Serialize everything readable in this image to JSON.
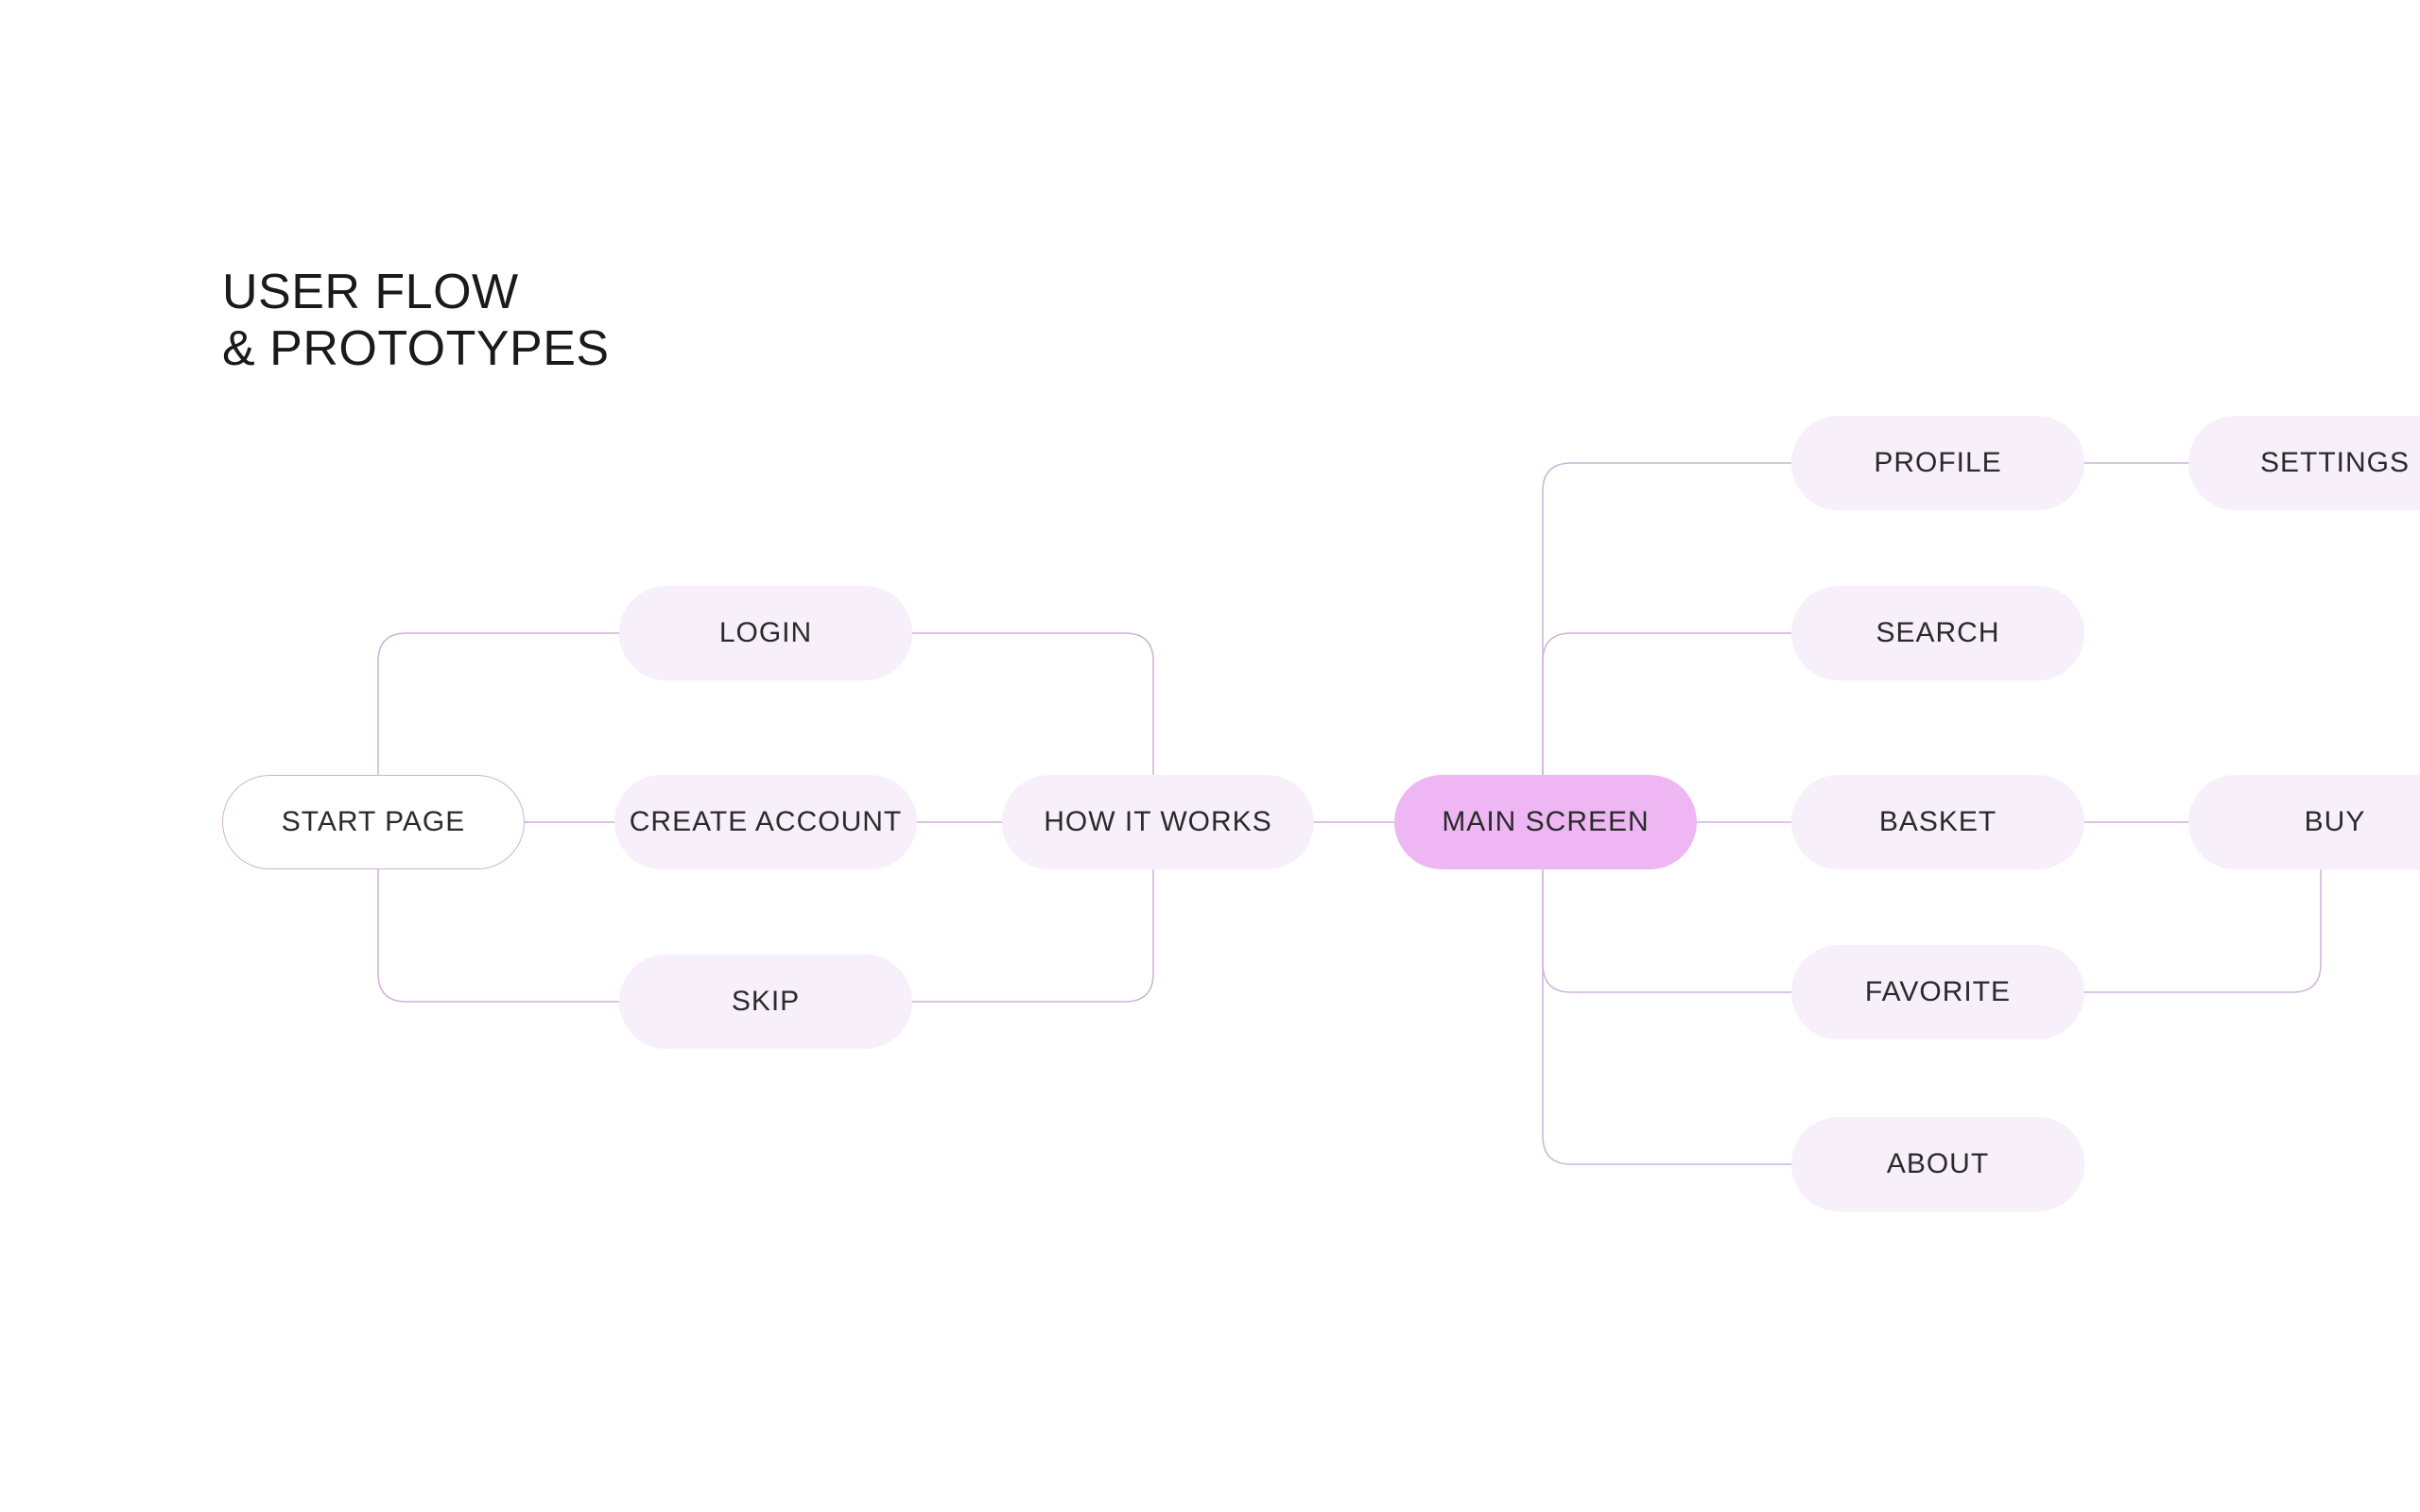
{
  "title_line1": "USER FLOW",
  "title_line2": "& PROTOTYPES",
  "nodes": {
    "start_page": "START PAGE",
    "login": "LOGIN",
    "create_account": "CREATE ACCOUNT",
    "skip": "SKIP",
    "how_it_works": "HOW IT WORKS",
    "main_screen": "MAIN SCREEN",
    "profile": "PROFILE",
    "search": "SEARCH",
    "basket": "BASKET",
    "favorite": "FAVORITE",
    "about": "ABOUT",
    "settings": "SETTINGS",
    "buy": "BUY"
  },
  "colors": {
    "node_light": "#f7effa",
    "node_accent": "#eeb7f4",
    "connector": "#cfb2d8",
    "text": "#2a2a2a"
  }
}
